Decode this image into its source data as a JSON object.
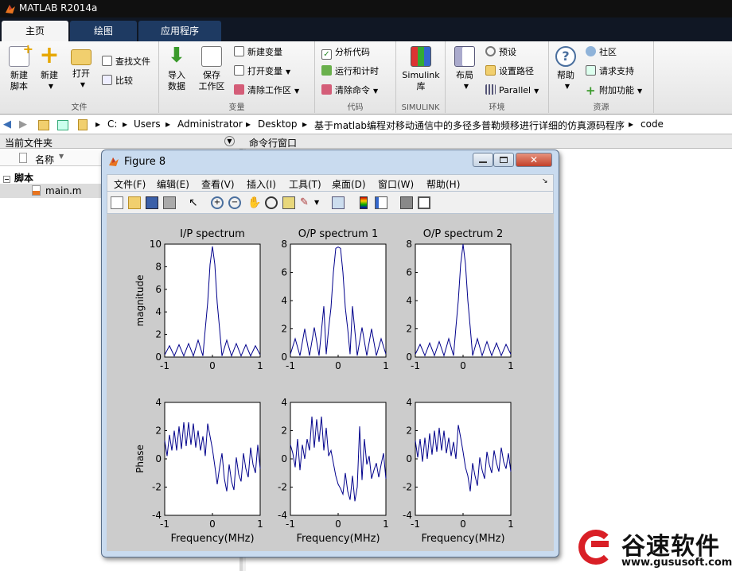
{
  "window": {
    "title": "MATLAB R2014a"
  },
  "tabs": [
    {
      "label": "主页",
      "active": true
    },
    {
      "label": "绘图",
      "active": false
    },
    {
      "label": "应用程序",
      "active": false
    }
  ],
  "ribbon": {
    "groups": [
      {
        "label": "文件"
      },
      {
        "label": "变量"
      },
      {
        "label": "代码"
      },
      {
        "label": "SIMULINK"
      },
      {
        "label": "环境"
      },
      {
        "label": "资源"
      }
    ],
    "new_script": "新建\n脚本",
    "new": "新建",
    "open": "打开",
    "find_files": "查找文件",
    "compare": "比较",
    "import_data": "导入\n数据",
    "save_workspace": "保存\n工作区",
    "new_variable": "新建变量",
    "open_variable": "打开变量",
    "clear_workspace": "清除工作区",
    "analyze_code": "分析代码",
    "run_and_time": "运行和计时",
    "clear_commands": "清除命令",
    "simulink_library": "Simulink\n库",
    "layout": "布局",
    "preferences": "预设",
    "set_path": "设置路径",
    "parallel": "Parallel",
    "help": "帮助",
    "community": "社区",
    "request_support": "请求支持",
    "add_ons": "附加功能"
  },
  "address": {
    "crumbs": [
      "C:",
      "Users",
      "Administrator",
      "Desktop",
      "基于matlab编程对移动通信中的多径多普勒频移进行详细的仿真源码程序",
      "code"
    ]
  },
  "panes": {
    "current_folder": "当前文件夹",
    "command_window": "命令行窗口",
    "name_column": "名称",
    "folder_group": "脚本",
    "file": "main.m"
  },
  "figure": {
    "title": "Figure 8",
    "menu": [
      "文件(F)",
      "编辑(E)",
      "查看(V)",
      "插入(I)",
      "工具(T)",
      "桌面(D)",
      "窗口(W)",
      "帮助(H)"
    ],
    "toolbar_icons": [
      "new-figure-icon",
      "open-file-icon",
      "save-icon",
      "print-icon",
      "select-arrow-icon",
      "zoom-in-icon",
      "zoom-out-icon",
      "pan-hand-icon",
      "rotate-3d-icon",
      "data-cursor-icon",
      "brush-icon",
      "link-plot-icon",
      "colorbar-icon",
      "legend-icon",
      "hide-plot-tools-icon",
      "show-plot-tools-icon"
    ]
  },
  "chart_data": [
    {
      "type": "line",
      "title": "I/P spectrum",
      "ylabel": "magnitude",
      "xlabel": "",
      "xlim": [
        -1,
        1
      ],
      "ylim": [
        0,
        10
      ],
      "xticks": [
        "-1",
        "0",
        "1"
      ],
      "yticks": [
        "0",
        "2",
        "4",
        "6",
        "8",
        "10"
      ],
      "x": [
        -1,
        -0.9,
        -0.8,
        -0.7,
        -0.6,
        -0.5,
        -0.4,
        -0.3,
        -0.2,
        -0.15,
        -0.1,
        -0.05,
        0,
        0.05,
        0.1,
        0.15,
        0.2,
        0.3,
        0.4,
        0.5,
        0.6,
        0.7,
        0.8,
        0.9,
        1
      ],
      "series": [
        {
          "values": [
            0.2,
            1.0,
            0.1,
            1.1,
            0.1,
            1.2,
            0.1,
            1.5,
            0.1,
            2.5,
            4.8,
            8.2,
            9.8,
            8.2,
            4.8,
            2.5,
            0.1,
            1.5,
            0.1,
            1.2,
            0.1,
            1.1,
            0.1,
            1.0,
            0.2
          ],
          "color": "#00008b"
        }
      ]
    },
    {
      "type": "line",
      "title": "O/P spectrum 1",
      "ylabel": "",
      "xlabel": "",
      "xlim": [
        -1,
        1
      ],
      "ylim": [
        0,
        8
      ],
      "xticks": [
        "-1",
        "0",
        "1"
      ],
      "yticks": [
        "0",
        "2",
        "4",
        "6",
        "8"
      ],
      "x": [
        -1,
        -0.9,
        -0.8,
        -0.7,
        -0.6,
        -0.5,
        -0.4,
        -0.3,
        -0.25,
        -0.2,
        -0.15,
        -0.1,
        -0.05,
        0,
        0.05,
        0.1,
        0.15,
        0.2,
        0.25,
        0.3,
        0.4,
        0.5,
        0.6,
        0.7,
        0.8,
        0.9,
        1
      ],
      "series": [
        {
          "values": [
            0.2,
            1.3,
            0.1,
            2.0,
            0.1,
            2.1,
            0.1,
            3.6,
            0.2,
            2.0,
            3.5,
            6.0,
            7.7,
            7.8,
            7.7,
            6.0,
            3.5,
            2.0,
            0.2,
            3.6,
            0.1,
            2.1,
            0.1,
            2.0,
            0.1,
            1.3,
            0.2
          ],
          "color": "#00008b"
        }
      ]
    },
    {
      "type": "line",
      "title": "O/P spectrum 2",
      "ylabel": "",
      "xlabel": "",
      "xlim": [
        -1,
        1
      ],
      "ylim": [
        0,
        8
      ],
      "xticks": [
        "-1",
        "0",
        "1"
      ],
      "yticks": [
        "0",
        "2",
        "4",
        "6",
        "8"
      ],
      "x": [
        -1,
        -0.9,
        -0.8,
        -0.7,
        -0.6,
        -0.5,
        -0.4,
        -0.3,
        -0.2,
        -0.15,
        -0.1,
        -0.05,
        0,
        0.05,
        0.1,
        0.15,
        0.2,
        0.3,
        0.4,
        0.5,
        0.6,
        0.7,
        0.8,
        0.9,
        1
      ],
      "series": [
        {
          "values": [
            0.2,
            0.9,
            0.1,
            1.0,
            0.1,
            1.1,
            0.1,
            1.3,
            0.1,
            2.1,
            4.0,
            6.6,
            8.0,
            6.6,
            4.0,
            2.1,
            0.1,
            1.3,
            0.1,
            1.1,
            0.1,
            1.0,
            0.1,
            0.9,
            0.2
          ],
          "color": "#00008b"
        }
      ]
    },
    {
      "type": "line",
      "title": "",
      "ylabel": "Phase",
      "xlabel": "Frequency(MHz)",
      "xlim": [
        -1,
        1
      ],
      "ylim": [
        -4,
        4
      ],
      "xticks": [
        "-1",
        "0",
        "1"
      ],
      "yticks": [
        "-4",
        "-2",
        "0",
        "2",
        "4"
      ],
      "x": [
        -1,
        -0.95,
        -0.9,
        -0.85,
        -0.8,
        -0.75,
        -0.7,
        -0.65,
        -0.6,
        -0.55,
        -0.5,
        -0.45,
        -0.4,
        -0.35,
        -0.3,
        -0.25,
        -0.2,
        -0.15,
        -0.1,
        -0.05,
        0,
        0.05,
        0.1,
        0.15,
        0.2,
        0.25,
        0.3,
        0.35,
        0.4,
        0.45,
        0.5,
        0.55,
        0.6,
        0.65,
        0.7,
        0.75,
        0.8,
        0.85,
        0.9,
        0.95,
        1
      ],
      "series": [
        {
          "values": [
            1.3,
            0.2,
            1.7,
            0.6,
            2.0,
            0.6,
            2.3,
            0.7,
            2.6,
            0.9,
            2.6,
            1.0,
            2.5,
            0.8,
            2.0,
            0.6,
            1.6,
            0.2,
            2.5,
            1.6,
            0.7,
            -0.5,
            -1.8,
            -0.6,
            0.4,
            -1.4,
            -2.3,
            -0.4,
            -1.6,
            -2.2,
            0.1,
            -1.1,
            -1.6,
            0.4,
            -0.7,
            -1.3,
            0.8,
            -0.4,
            -1.0,
            1.0,
            -0.7
          ],
          "color": "#00008b"
        }
      ]
    },
    {
      "type": "line",
      "title": "",
      "ylabel": "",
      "xlabel": "Frequency(MHz)",
      "xlim": [
        -1,
        1
      ],
      "ylim": [
        -4,
        4
      ],
      "xticks": [
        "-1",
        "0",
        "1"
      ],
      "yticks": [
        "-4",
        "-2",
        "0",
        "2",
        "4"
      ],
      "x": [
        -1,
        -0.95,
        -0.9,
        -0.85,
        -0.8,
        -0.75,
        -0.7,
        -0.65,
        -0.6,
        -0.55,
        -0.5,
        -0.45,
        -0.4,
        -0.35,
        -0.3,
        -0.25,
        -0.2,
        -0.15,
        -0.1,
        -0.05,
        0,
        0.05,
        0.1,
        0.15,
        0.2,
        0.25,
        0.3,
        0.35,
        0.4,
        0.45,
        0.5,
        0.55,
        0.6,
        0.65,
        0.7,
        0.75,
        0.8,
        0.85,
        0.9,
        0.95,
        1
      ],
      "series": [
        {
          "values": [
            1.0,
            0.4,
            -0.6,
            1.4,
            -0.8,
            1.0,
            0.0,
            1.4,
            0.6,
            3.0,
            0.8,
            2.8,
            1.2,
            3.0,
            0.6,
            2.2,
            0.2,
            0.6,
            -0.3,
            -1.2,
            -1.8,
            -2.1,
            -2.5,
            -1.0,
            -2.3,
            -2.9,
            -1.2,
            -3.0,
            -2.0,
            2.3,
            -1.5,
            1.4,
            -0.4,
            0.2,
            -1.4,
            -0.8,
            -0.3,
            -1.3,
            -0.4,
            0.4,
            -1.4
          ],
          "color": "#00008b"
        }
      ]
    },
    {
      "type": "line",
      "title": "",
      "ylabel": "",
      "xlabel": "Frequency(MHz)",
      "xlim": [
        -1,
        1
      ],
      "ylim": [
        -4,
        4
      ],
      "xticks": [
        "-1",
        "0",
        "1"
      ],
      "yticks": [
        "-4",
        "-2",
        "0",
        "2",
        "4"
      ],
      "x": [
        -1,
        -0.95,
        -0.9,
        -0.85,
        -0.8,
        -0.75,
        -0.7,
        -0.65,
        -0.6,
        -0.55,
        -0.5,
        -0.45,
        -0.4,
        -0.35,
        -0.3,
        -0.25,
        -0.2,
        -0.15,
        -0.1,
        -0.05,
        0,
        0.05,
        0.1,
        0.15,
        0.2,
        0.25,
        0.3,
        0.35,
        0.4,
        0.45,
        0.5,
        0.55,
        0.6,
        0.65,
        0.7,
        0.75,
        0.8,
        0.85,
        0.9,
        0.95,
        1
      ],
      "series": [
        {
          "values": [
            1.3,
            0.1,
            1.4,
            -0.2,
            1.5,
            0.0,
            1.8,
            0.3,
            2.0,
            0.5,
            2.2,
            0.6,
            2.0,
            0.4,
            1.5,
            0.2,
            1.2,
            0.0,
            2.4,
            1.5,
            0.5,
            -0.6,
            -1.2,
            -2.3,
            -0.3,
            -1.2,
            -1.9,
            0.1,
            -0.8,
            -1.4,
            0.5,
            -0.4,
            -1.0,
            0.6,
            -0.3,
            -0.9,
            0.8,
            -0.2,
            -0.7,
            0.4,
            -0.9
          ],
          "color": "#00008b"
        }
      ]
    }
  ],
  "watermark": {
    "brand": "谷速软件",
    "url": "www.gususoft.com"
  }
}
